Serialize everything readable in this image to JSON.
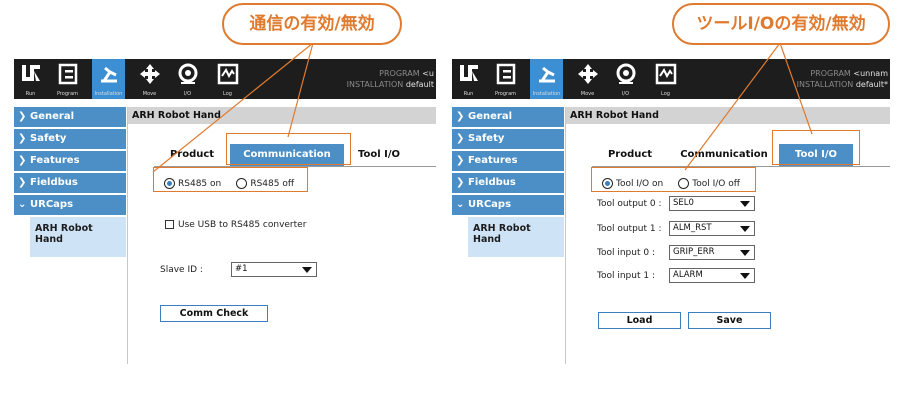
{
  "accent_color": "#4c8fc6",
  "highlight_color": "#e07a2e",
  "topbar": {
    "buttons": [
      {
        "label": "Run",
        "icon": "ur-logo-icon"
      },
      {
        "label": "Program",
        "icon": "program-icon"
      },
      {
        "label": "Installation",
        "icon": "installation-icon"
      },
      {
        "label": "Move",
        "icon": "move-icon"
      },
      {
        "label": "I/O",
        "icon": "io-icon"
      },
      {
        "label": "Log",
        "icon": "log-icon"
      }
    ]
  },
  "panelA": {
    "program_label": "PROGRAM",
    "program_value": "<u",
    "installation_label": "INSTALLATION",
    "installation_value": "default",
    "callout": "通信の有効/無効",
    "sidebar": [
      "General",
      "Safety",
      "Features",
      "Fieldbus",
      "URCaps"
    ],
    "sidebar_sub": [
      "ARH Robot",
      "Hand"
    ],
    "title": "ARH Robot Hand",
    "tabs": [
      "Product",
      "Communication",
      "Tool I/O"
    ],
    "radios": [
      "RS485 on",
      "RS485 off"
    ],
    "checkbox": "Use USB to RS485 converter",
    "slave_label": "Slave ID :",
    "slave_value": "#1",
    "check_button": "Comm Check"
  },
  "panelB": {
    "program_label": "PROGRAM",
    "program_value": "<unnam",
    "installation_label": "INSTALLATION",
    "installation_value": "default*",
    "callout": "ツールI/Oの有効/無効",
    "sidebar": [
      "General",
      "Safety",
      "Features",
      "Fieldbus",
      "URCaps"
    ],
    "sidebar_sub": [
      "ARH Robot",
      "Hand"
    ],
    "title": "ARH Robot Hand",
    "tabs": [
      "Product",
      "Communication",
      "Tool I/O"
    ],
    "radios": [
      "Tool I/O on",
      "Tool I/O off"
    ],
    "io_rows": [
      {
        "label": "Tool output 0 :",
        "value": "SEL0"
      },
      {
        "label": "Tool output 1 :",
        "value": "ALM_RST"
      },
      {
        "label": "Tool input 0 :",
        "value": "GRIP_ERR"
      },
      {
        "label": "Tool input 1 :",
        "value": "ALARM"
      }
    ],
    "load_button": "Load",
    "save_button": "Save"
  }
}
